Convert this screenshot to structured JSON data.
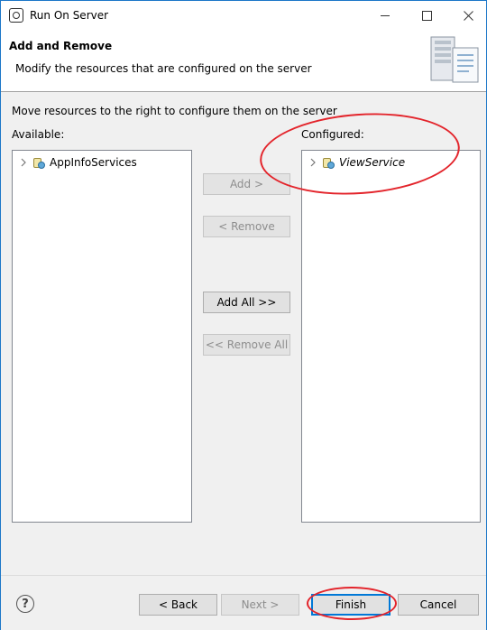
{
  "window": {
    "title": "Run On Server"
  },
  "header": {
    "title": "Add and Remove",
    "description": "Modify the resources that are configured on the server"
  },
  "content": {
    "instructions": "Move resources to the right to configure them on the server",
    "available_label": "Available:",
    "configured_label": "Configured:",
    "available_items": [
      {
        "label": "AppInfoServices",
        "icon": "web-project-icon",
        "expand_icon": "chevron-right-icon"
      }
    ],
    "configured_items": [
      {
        "label": "ViewService",
        "icon": "web-project-icon",
        "expand_icon": "chevron-right-icon",
        "italic": true
      }
    ]
  },
  "buttons": {
    "add": {
      "label": "Add >",
      "enabled": false
    },
    "remove": {
      "label": "< Remove",
      "enabled": false
    },
    "add_all": {
      "label": "Add All >>",
      "enabled": true
    },
    "remove_all": {
      "label": "<< Remove All",
      "enabled": false
    },
    "back": {
      "label": "< Back",
      "enabled": true
    },
    "next": {
      "label": "Next >",
      "enabled": false
    },
    "finish": {
      "label": "Finish",
      "enabled": true,
      "default": true
    },
    "cancel": {
      "label": "Cancel",
      "enabled": true
    }
  },
  "help": {
    "icon": "help-icon",
    "glyph": "?"
  },
  "colors": {
    "annotation": "#e3242b",
    "focus_border": "#0078d7",
    "window_border": "#1c77c8"
  }
}
